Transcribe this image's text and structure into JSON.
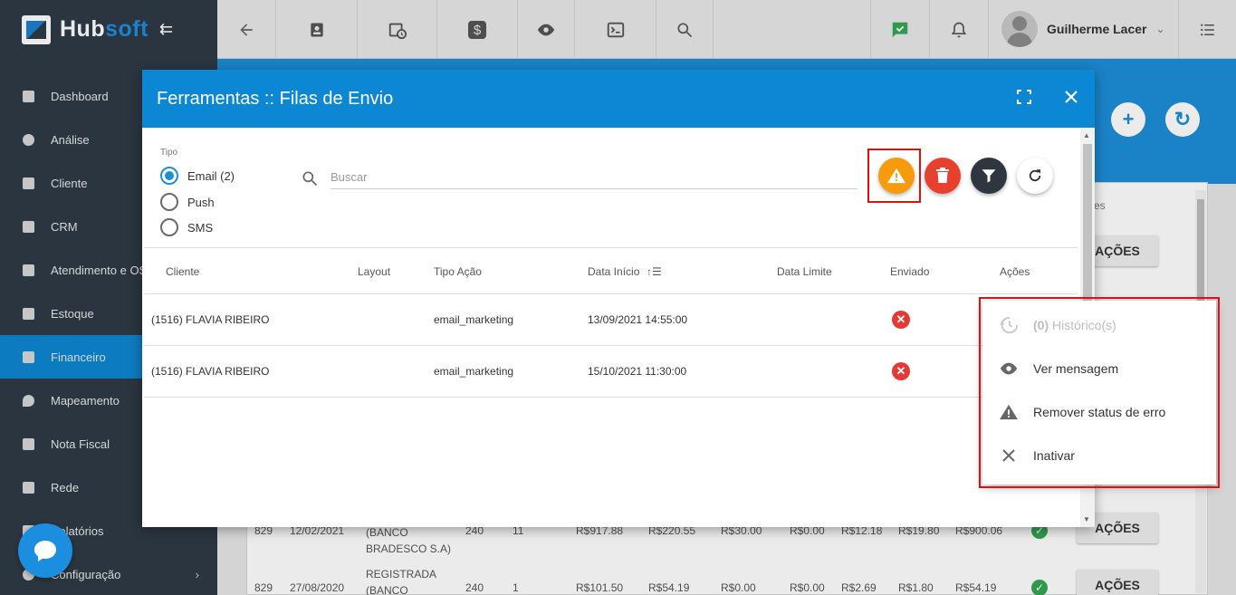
{
  "app": {
    "logo_main": "Hub",
    "logo_accent": "soft",
    "collapse_icon": "⇇"
  },
  "user": {
    "name": "Guilherme Lacer"
  },
  "sidebar": {
    "items": [
      {
        "label": "Dashboard"
      },
      {
        "label": "Análise"
      },
      {
        "label": "Cliente"
      },
      {
        "label": "CRM"
      },
      {
        "label": "Atendimento e OS"
      },
      {
        "label": "Estoque"
      },
      {
        "label": "Financeiro"
      },
      {
        "label": "Mapeamento"
      },
      {
        "label": "Nota Fiscal"
      },
      {
        "label": "Rede"
      },
      {
        "label": "Relatórios"
      },
      {
        "label": "Configuração"
      }
    ],
    "active_index": 6
  },
  "modal": {
    "title": "Ferramentas :: Filas de Envio",
    "tipo_label": "Tipo",
    "tipo_options": [
      "Email (2)",
      "Push",
      "SMS"
    ],
    "selected_tipo": "Email (2)",
    "search_placeholder": "Buscar",
    "columns": [
      "Cliente",
      "Layout",
      "Tipo Ação",
      "Data Início",
      "Data Limite",
      "Enviado",
      "Ações"
    ],
    "rows": [
      {
        "cliente": "(1516) FLAVIA RIBEIRO",
        "layout": "",
        "tipo_acao": "email_marketing",
        "data_inicio": "13/09/2021 14:55:00",
        "data_limite": "",
        "enviado": false
      },
      {
        "cliente": "(1516) FLAVIA RIBEIRO",
        "layout": "",
        "tipo_acao": "email_marketing",
        "data_inicio": "15/10/2021 11:30:00",
        "data_limite": "",
        "enviado": false
      }
    ]
  },
  "context_menu": {
    "historico_count": "(0)",
    "historico_label": "Histórico(s)",
    "ver_mensagem": "Ver mensagem",
    "remover_status": "Remover status de erro",
    "inativar": "Inativar"
  },
  "background": {
    "header_fragment": "es",
    "acoes_label": "AÇÕES",
    "rows": [
      {
        "id": "829",
        "date": "12/02/2021",
        "status": "(BANCO BRADESCO S.A)",
        "c1": "240",
        "c2": "11",
        "v1": "R$917.88",
        "v2": "R$220.55",
        "v3": "R$30.00",
        "v4": "R$0.00",
        "v5": "R$12.18",
        "v6": "R$19.80",
        "v7": "R$900.06"
      },
      {
        "id": "829",
        "date": "27/08/2020",
        "status": "REGISTRADA (BANCO",
        "c1": "240",
        "c2": "1",
        "v1": "R$101.50",
        "v2": "R$54.19",
        "v3": "R$0.00",
        "v4": "R$0.00",
        "v5": "R$2.69",
        "v6": "R$1.80",
        "v7": "R$54.19"
      }
    ]
  },
  "colors": {
    "primary": "#0c87d3",
    "warning": "#f59b0c",
    "danger": "#e8402f",
    "dark": "#2f3640",
    "highlight": "#e20f0f"
  }
}
